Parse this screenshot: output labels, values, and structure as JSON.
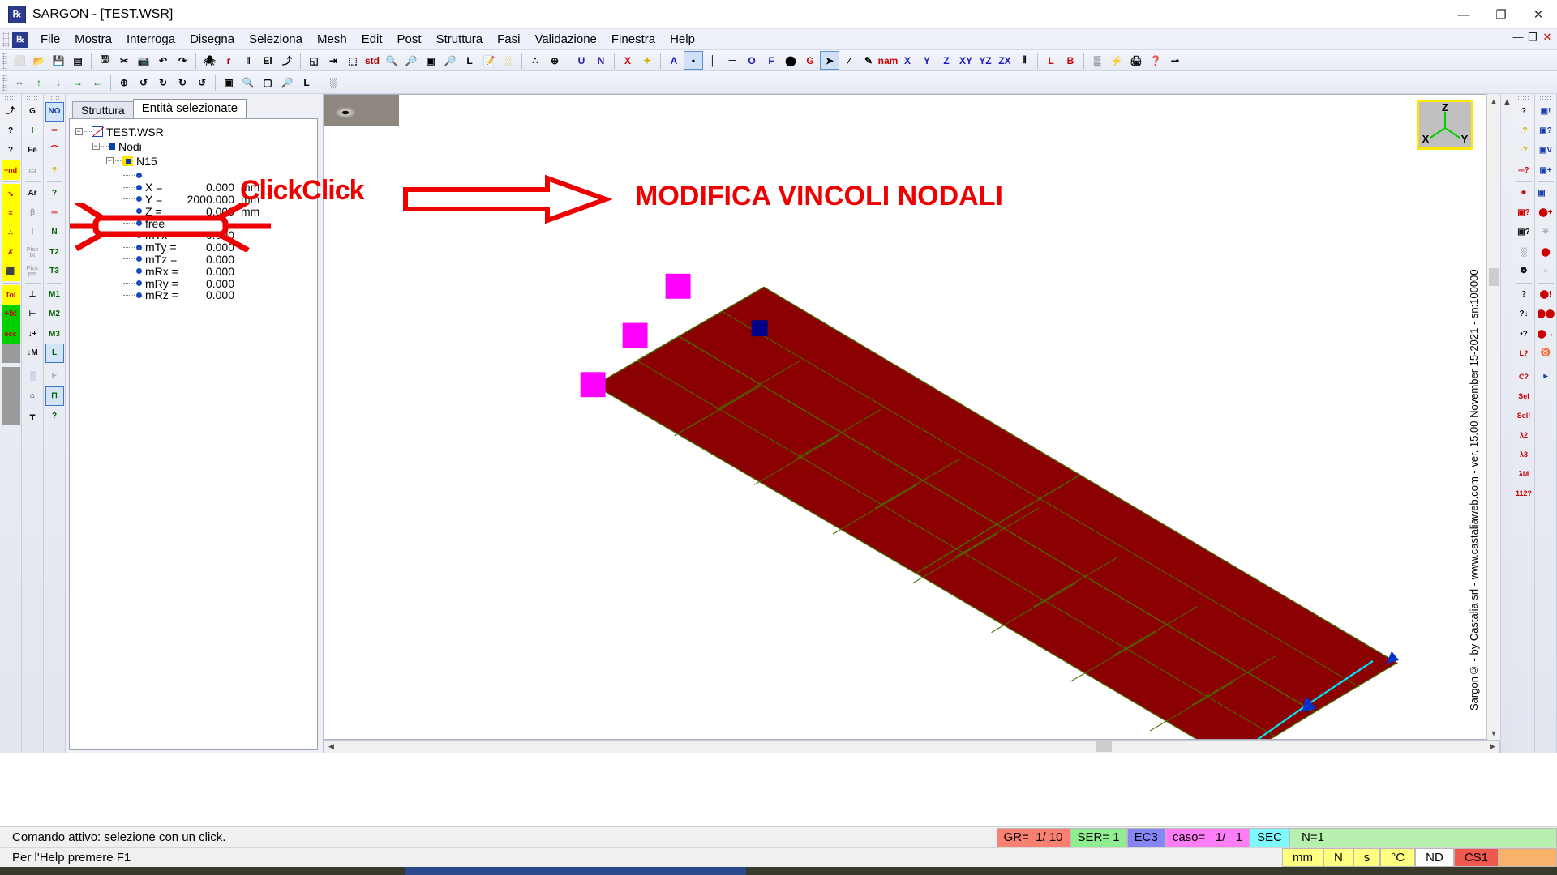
{
  "window": {
    "app_icon": "sargon-logo-icon",
    "title": "SARGON - [TEST.WSR]",
    "minimize": "—",
    "maximize": "❐",
    "close": "✕"
  },
  "menubar": {
    "items": [
      {
        "label": "File"
      },
      {
        "label": "Mostra"
      },
      {
        "label": "Interroga"
      },
      {
        "label": "Disegna"
      },
      {
        "label": "Seleziona"
      },
      {
        "label": "Mesh"
      },
      {
        "label": "Edit"
      },
      {
        "label": "Post"
      },
      {
        "label": "Struttura"
      },
      {
        "label": "Fasi"
      },
      {
        "label": "Validazione"
      },
      {
        "label": "Finestra"
      },
      {
        "label": "Help"
      }
    ],
    "doc_buttons": [
      "—",
      "❐",
      "✕"
    ]
  },
  "toolbar1": {
    "items": [
      {
        "name": "new-file-icon",
        "glyph": "⬜"
      },
      {
        "name": "open-folder-icon",
        "glyph": "📂"
      },
      {
        "name": "save-icon",
        "glyph": "💾"
      },
      {
        "name": "save-as-icon",
        "glyph": "▤"
      },
      {
        "sep": true
      },
      {
        "name": "calculator-icon",
        "glyph": "🖫"
      },
      {
        "name": "cut-scissors-icon",
        "glyph": "✂"
      },
      {
        "name": "camera-icon",
        "glyph": "📷"
      },
      {
        "name": "undo-icon",
        "glyph": "↶"
      },
      {
        "name": "redo-icon",
        "glyph": "↷"
      },
      {
        "sep": true
      },
      {
        "name": "spider-icon",
        "glyph": "🕷"
      },
      {
        "name": "r-label-icon",
        "glyph": "r"
      },
      {
        "name": "color-bands-icon",
        "glyph": "‖"
      },
      {
        "name": "el-label-icon",
        "glyph": "El"
      },
      {
        "name": "axes-icon",
        "glyph": "⤴"
      },
      {
        "sep": true
      },
      {
        "name": "fit-window-icon",
        "glyph": "◱"
      },
      {
        "name": "measure-icon",
        "glyph": "⇥"
      },
      {
        "name": "mesh-node-icon",
        "glyph": "⬚"
      },
      {
        "name": "std-view-icon",
        "glyph": "std"
      },
      {
        "name": "zoom-window-icon",
        "glyph": "🔍"
      },
      {
        "name": "zoom-in-icon",
        "glyph": "🔎"
      },
      {
        "name": "zoom-area-icon",
        "glyph": "▣"
      },
      {
        "name": "zoom-out-icon",
        "glyph": "🔎"
      },
      {
        "name": "zoom-last-icon",
        "glyph": "L"
      },
      {
        "name": "edit-doc-icon",
        "glyph": "📝"
      },
      {
        "name": "grid-strip-icon",
        "glyph": "░"
      },
      {
        "sep": true
      },
      {
        "name": "points-icon",
        "glyph": "∴"
      },
      {
        "name": "globe-icon",
        "glyph": "⊕"
      },
      {
        "sep": true
      },
      {
        "name": "u-label-icon",
        "glyph": "U"
      },
      {
        "name": "n-label-icon",
        "glyph": "N"
      },
      {
        "sep": true
      },
      {
        "name": "x-delete-icon",
        "glyph": "X"
      },
      {
        "name": "sparkle-icon",
        "glyph": "✦"
      },
      {
        "sep": true
      },
      {
        "name": "a-label-icon",
        "glyph": "A"
      },
      {
        "name": "node-highlight-icon",
        "glyph": "•"
      },
      {
        "name": "beam-icon",
        "glyph": "│"
      },
      {
        "name": "bands-icon",
        "glyph": "═"
      },
      {
        "name": "o-label-icon",
        "glyph": "O"
      },
      {
        "name": "f-label-icon",
        "glyph": "F"
      },
      {
        "name": "solid-icon",
        "glyph": "⬤"
      },
      {
        "name": "g-label-icon",
        "glyph": "G"
      },
      {
        "name": "cursor-arrow-icon",
        "glyph": "➤"
      },
      {
        "name": "diagonal-slash-icon",
        "glyph": "∕"
      },
      {
        "name": "pencil-icon",
        "glyph": "✎"
      },
      {
        "name": "nam-label-icon",
        "glyph": "nam"
      },
      {
        "name": "view-x-icon",
        "glyph": "X"
      },
      {
        "name": "view-y-icon",
        "glyph": "Y"
      },
      {
        "name": "view-z-icon",
        "glyph": "Z"
      },
      {
        "name": "view-xy-icon",
        "glyph": "XY"
      },
      {
        "name": "view-yz-icon",
        "glyph": "YZ"
      },
      {
        "name": "view-zx-icon",
        "glyph": "ZX"
      },
      {
        "name": "columns-icon",
        "glyph": "⫴"
      },
      {
        "sep": true
      },
      {
        "name": "local-axis-l-icon",
        "glyph": "L"
      },
      {
        "name": "local-axis-b-icon",
        "glyph": "B"
      },
      {
        "sep": true
      },
      {
        "name": "table-icon",
        "glyph": "▒"
      },
      {
        "name": "lightning-icon",
        "glyph": "⚡"
      },
      {
        "name": "print-icon",
        "glyph": "🖨"
      },
      {
        "name": "help-pointer-icon",
        "glyph": "❓"
      },
      {
        "name": "chain-icon",
        "glyph": "⊸"
      }
    ]
  },
  "toolbar2": {
    "items": [
      {
        "name": "distance-icon",
        "glyph": "⇔"
      },
      {
        "name": "move-up-icon",
        "glyph": "↑"
      },
      {
        "name": "move-down-icon",
        "glyph": "↓"
      },
      {
        "name": "move-right-icon",
        "glyph": "→"
      },
      {
        "name": "move-left-icon",
        "glyph": "←"
      },
      {
        "sep": true
      },
      {
        "name": "rotate-globe-icon",
        "glyph": "⊕"
      },
      {
        "name": "rotate-plus-x-icon",
        "glyph": "↺"
      },
      {
        "name": "rotate-minus-x-icon",
        "glyph": "↻"
      },
      {
        "name": "rotate-plus-y-icon",
        "glyph": "↻"
      },
      {
        "name": "rotate-minus-y-icon",
        "glyph": "↺"
      },
      {
        "sep": true
      },
      {
        "name": "zoom-box-icon",
        "glyph": "▣"
      },
      {
        "name": "zoom-plus-icon",
        "glyph": "🔍"
      },
      {
        "name": "zoom-fit-icon",
        "glyph": "▢"
      },
      {
        "name": "zoom-minus-icon",
        "glyph": "🔎"
      },
      {
        "name": "zoom-previous-icon",
        "glyph": "L"
      },
      {
        "sep": true
      },
      {
        "name": "grid-toggle-icon",
        "glyph": "░"
      }
    ]
  },
  "left_rails": {
    "rail1": [
      "axes-icon",
      "?",
      ".?",
      "+nd",
      "arrow-node-icon",
      "beam-edit-icon",
      "node-add-icon",
      "delete-x-icon",
      "column-icon",
      "Tol",
      "+bt",
      "ecc",
      "blank1",
      "blank2",
      "blank3",
      "blank4"
    ],
    "rail1_labels": [
      "⤴",
      "?",
      "?",
      "+nd",
      "↘",
      "≡",
      "∴",
      "✗",
      "⬛",
      "Tol",
      "+bt",
      "ecc",
      "",
      "",
      "",
      ""
    ],
    "rail2_labels": [
      "G",
      "I",
      "Fe",
      "▭",
      "Ar",
      "β",
      "I",
      "Pick bt",
      "Pick pm",
      "⊥",
      "⊢",
      "↓+",
      "↓M",
      "░",
      "⌂",
      "┳"
    ],
    "rail3_labels": [
      "NO",
      "━",
      "⌒",
      "?",
      "?",
      "═",
      "N",
      "T2",
      "T3",
      "M1",
      "M2",
      "M3",
      "L",
      "E",
      "⊓",
      "?"
    ]
  },
  "right_rails": {
    "rail1_labels": [
      "?",
      ".?",
      "·?",
      "═?",
      "⚭",
      "▣?",
      "▣?",
      "░",
      "❁",
      "?",
      "?↓",
      "•?",
      "L?",
      "C?",
      "Sel",
      "Sel!",
      "λ2",
      "λ3",
      "λM",
      "112?"
    ],
    "rail2_labels": [
      "▣!",
      "▣?",
      "▣V",
      "▣+",
      "▣→",
      "⬤+",
      "✳",
      "⬤",
      "○",
      "⬤!",
      "⬤⬤",
      "⬤→",
      "♉",
      "▸"
    ]
  },
  "panel": {
    "tabs": [
      {
        "label": "Struttura",
        "active": false
      },
      {
        "label": "Entità selezionate",
        "active": true
      }
    ],
    "tree": {
      "root": "TEST.WSR",
      "group": "Nodi",
      "node": "N15",
      "properties": [
        {
          "label": "",
          "value": "",
          "unit": ""
        },
        {
          "label": "X =",
          "value": "0.000",
          "unit": "mm"
        },
        {
          "label": "Y =",
          "value": "2000.000",
          "unit": "mm"
        },
        {
          "label": "Z =",
          "value": "0.000",
          "unit": "mm"
        },
        {
          "label": "free",
          "value": "",
          "unit": ""
        },
        {
          "label": "mTx =",
          "value": "0.000",
          "unit": ""
        },
        {
          "label": "mTy =",
          "value": "0.000",
          "unit": ""
        },
        {
          "label": "mTz =",
          "value": "0.000",
          "unit": ""
        },
        {
          "label": "mRx =",
          "value": "0.000",
          "unit": ""
        },
        {
          "label": "mRy =",
          "value": "0.000",
          "unit": ""
        },
        {
          "label": "mRz =",
          "value": "0.000",
          "unit": ""
        }
      ]
    }
  },
  "annotations": {
    "click_text": "ClickClick",
    "modifica_text": "MODIFICA VINCOLI NODALI",
    "accent_color": "#ee0000"
  },
  "viewport": {
    "axis_cube": {
      "x": "X",
      "y": "Y",
      "z": "Z"
    },
    "copyright": "Sargon© - by Castalia srl - www.castaliaweb.com - ver. 15.00 November 15-2021 - sn:100000"
  },
  "statusbar": {
    "message": "Comando attivo: selezione con un click.",
    "cells": [
      {
        "label": "GR=  1/ 10",
        "bg": "#fa8072",
        "fg": "#000000"
      },
      {
        "label": "SER= 1",
        "bg": "#90ee90",
        "fg": "#000000"
      },
      {
        "label": "EC3",
        "bg": "#8585f5",
        "fg": "#000000"
      },
      {
        "label": "caso=   1/   1",
        "bg": "#ff7ef5",
        "fg": "#000000"
      },
      {
        "label": "SEC",
        "bg": "#7efaff",
        "fg": "#000000"
      },
      {
        "label": "N=1",
        "bg": "#b8f0b0",
        "fg": "#000000"
      }
    ]
  },
  "statusbar2": {
    "help_message": "Per l'Help premere F1",
    "units": [
      {
        "label": "mm",
        "bg": "#ffff80"
      },
      {
        "label": "N",
        "bg": "#ffff80"
      },
      {
        "label": "s",
        "bg": "#ffff80"
      },
      {
        "label": "°C",
        "bg": "#ffff80"
      },
      {
        "label": "ND",
        "bg": "#ffffff"
      },
      {
        "label": "CS1",
        "bg": "#f0584e"
      },
      {
        "label": "",
        "bg": "#f8b26a"
      }
    ]
  }
}
